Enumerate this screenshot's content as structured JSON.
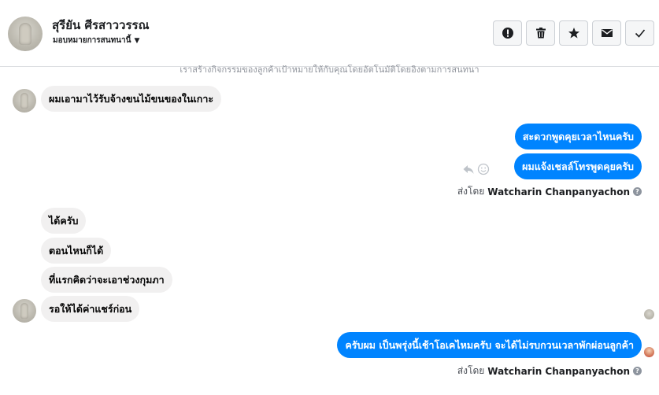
{
  "header": {
    "contact_name": "สุรียัน ศีรสาววรรณ",
    "assign_label": "มอบหมายการสนทนานี้",
    "actions": [
      {
        "name": "spam-button",
        "icon": "alert-circle-icon"
      },
      {
        "name": "delete-button",
        "icon": "trash-icon"
      },
      {
        "name": "star-button",
        "icon": "star-icon"
      },
      {
        "name": "mark-unread-button",
        "icon": "envelope-icon"
      },
      {
        "name": "mark-done-button",
        "icon": "check-icon"
      }
    ]
  },
  "system_note": "เราสร้างกิจกรรมของลูกค้าเป้าหมายให้กับคุณโดยอัตโนมัติโดยอิงตามการสนทนา",
  "messages": {
    "m1": "ผมเอามาไว้รับจ้างขนไม้ขนของในเกาะ",
    "m2": "สะดวกพูดคุยเวลาไหนครับ",
    "m3": "ผมแจ้งเชลล์โทรพูดคุยครับ",
    "m4": "ได้ครับ",
    "m5": "ตอนไหนก็ได้",
    "m6": "ที่แรกคิดว่าจะเอาช่วงกุมภา",
    "m7": "รอให้ได้ค่าแชร์ก่อน",
    "m8": "ครับผม เป็นพรุ่งนี้เช้าโอเคไหมครับ จะได้ไม่รบกวนเวลาพักผ่อนลูกค้า"
  },
  "sent_by": {
    "prefix": "ส่งโดย",
    "name": "Watcharin Chanpanyachon"
  },
  "colors": {
    "outgoing": "#0084ff",
    "incoming": "#f1f0f0"
  }
}
